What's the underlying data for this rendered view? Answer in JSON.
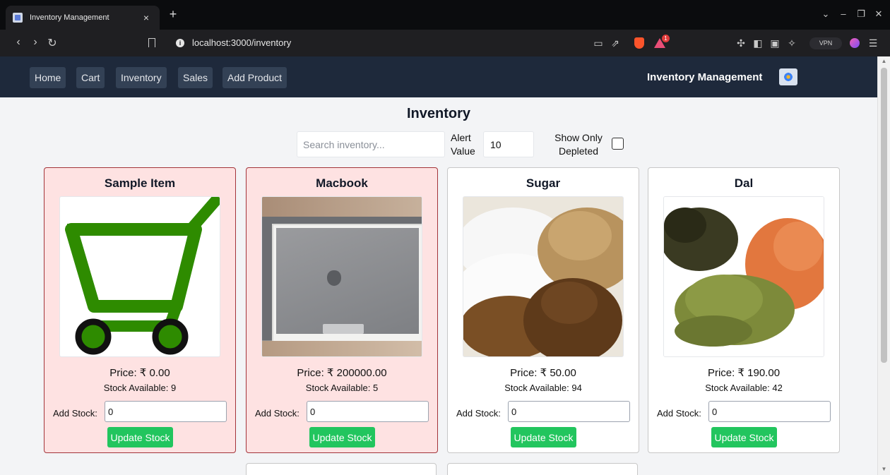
{
  "browser": {
    "tab_title": "Inventory Management",
    "tab_close": "×",
    "new_tab": "+",
    "url": "localhost:3000/inventory",
    "vpn_label": "VPN",
    "rewards_count": "1"
  },
  "navbar": {
    "links": [
      "Home",
      "Cart",
      "Inventory",
      "Sales",
      "Add Product"
    ],
    "brand": "Inventory Management"
  },
  "page": {
    "title": "Inventory",
    "search_placeholder": "Search inventory...",
    "alert_label": "Alert Value",
    "alert_value": "10",
    "depleted_label": "Show Only Depleted",
    "depleted_checked": false
  },
  "products": [
    {
      "name": "Sample Item",
      "price": "Price: ₹ 0.00",
      "stock": "Stock Available: 9",
      "add_label": "Add Stock:",
      "add_value": "0",
      "button": "Update Stock",
      "low_stock": true,
      "image": "cart-icon"
    },
    {
      "name": "Macbook",
      "price": "Price: ₹ 200000.00",
      "stock": "Stock Available: 5",
      "add_label": "Add Stock:",
      "add_value": "0",
      "button": "Update Stock",
      "low_stock": true,
      "image": "macbook-photo"
    },
    {
      "name": "Sugar",
      "price": "Price: ₹ 50.00",
      "stock": "Stock Available: 94",
      "add_label": "Add Stock:",
      "add_value": "0",
      "button": "Update Stock",
      "low_stock": false,
      "image": "sugar-photo"
    },
    {
      "name": "Dal",
      "price": "Price: ₹ 190.00",
      "stock": "Stock Available: 42",
      "add_label": "Add Stock:",
      "add_value": "0",
      "button": "Update Stock",
      "low_stock": false,
      "image": "dal-photo"
    }
  ],
  "colors": {
    "navbar_bg": "#1e293b",
    "nav_link_bg": "#334155",
    "alert_card_bg": "#fee2e2",
    "alert_card_border": "#a3343a",
    "button_green": "#22c55e",
    "cart_green": "#2e8b00"
  }
}
